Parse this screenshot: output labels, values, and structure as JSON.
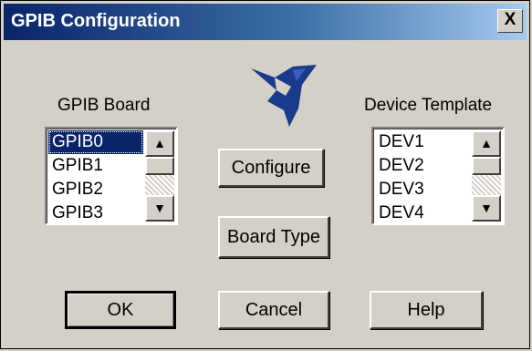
{
  "window": {
    "title": "GPIB Configuration",
    "close_label": "X"
  },
  "board": {
    "label": "GPIB Board",
    "items": [
      "GPIB0",
      "GPIB1",
      "GPIB2",
      "GPIB3"
    ],
    "selected": "GPIB0"
  },
  "template": {
    "label": "Device Template",
    "items": [
      "DEV1",
      "DEV2",
      "DEV3",
      "DEV4"
    ]
  },
  "buttons": {
    "configure": "Configure",
    "board_type": "Board Type",
    "ok": "OK",
    "cancel": "Cancel",
    "help": "Help"
  },
  "scroll": {
    "up": "▲",
    "down": "▼"
  },
  "colors": {
    "title_start": "#0a246a",
    "title_end": "#a6caf0",
    "selection": "#0a246a",
    "face": "#d4d0c8",
    "logo": "#1a3a8c"
  },
  "logo_icon": "ni-eagle-logo"
}
